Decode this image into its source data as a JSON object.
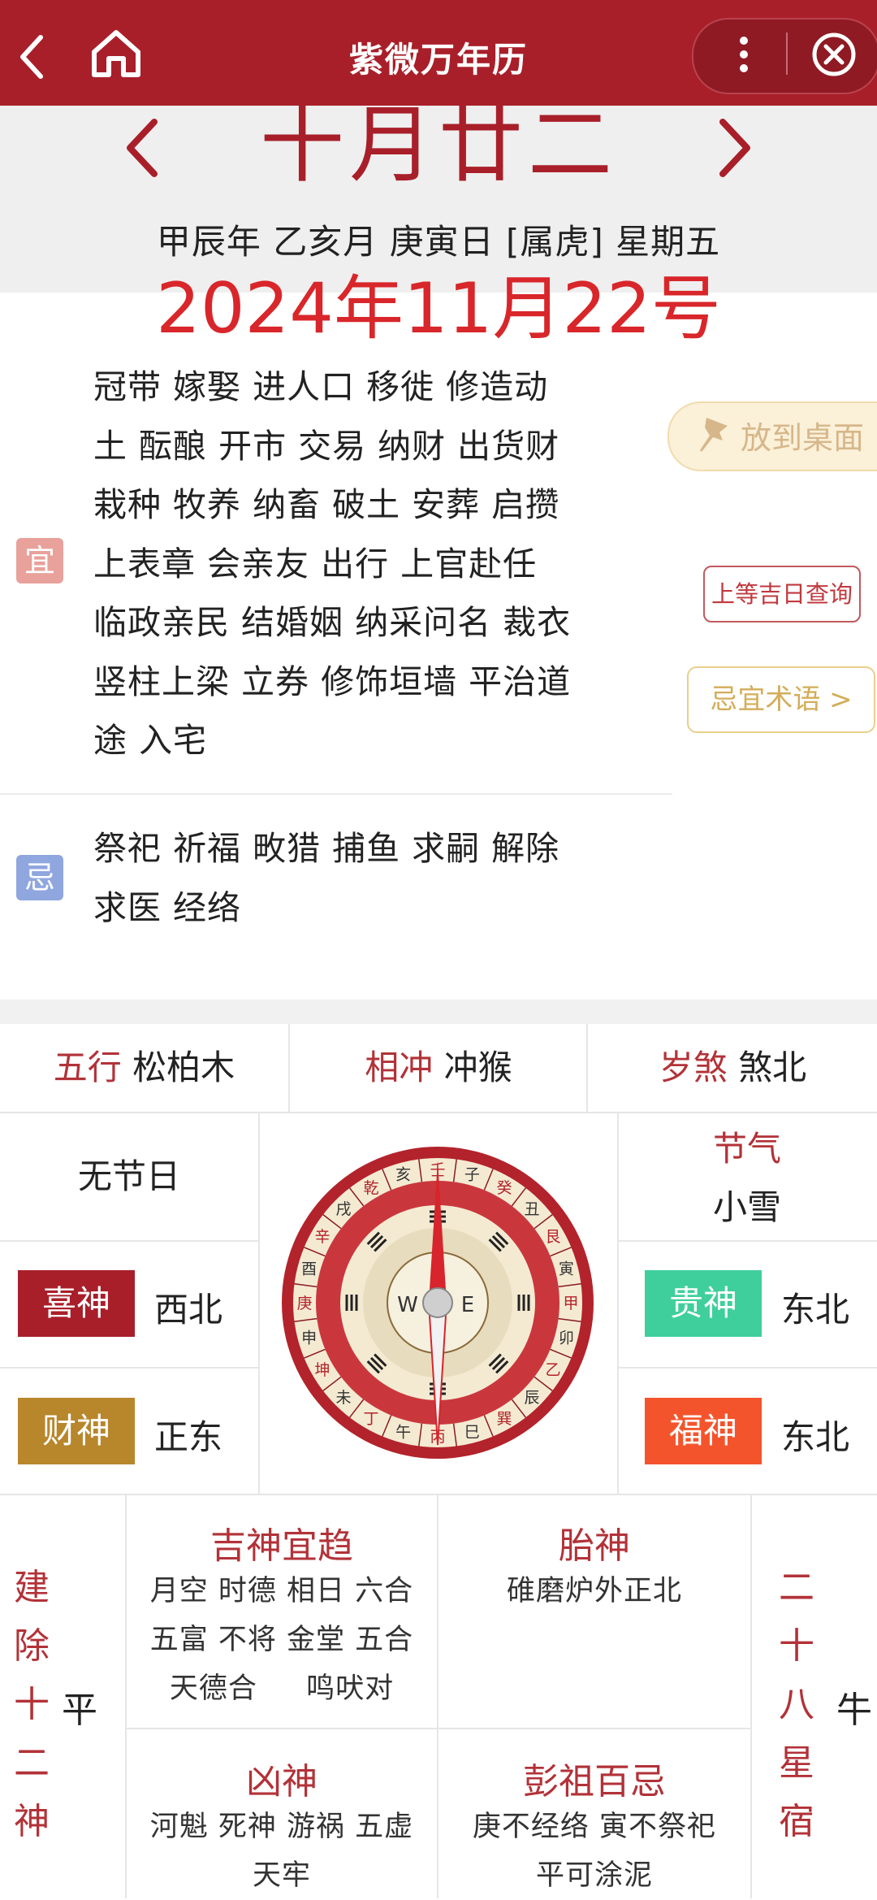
{
  "header": {
    "title": "紫微万年历"
  },
  "date": {
    "lunar": "十月廿二",
    "ganzhi": "甲辰年 乙亥月 庚寅日 [属虎] 星期五",
    "gregorian": "2024年11月22号"
  },
  "yi": {
    "tag": "宜",
    "lines": [
      "冠带 嫁娶 进人口 移徙 修造动",
      "土 酝酿 开市 交易 纳财 出货财",
      "栽种 牧养 纳畜 破土 安葬 启攒",
      "上表章 会亲友 出行 上官赴任",
      "临政亲民 结婚姻 纳采问名 裁衣",
      "竖柱上梁 立券 修饰垣墙 平治道",
      "途 入宅"
    ]
  },
  "ji": {
    "tag": "忌",
    "lines": [
      "祭祀 祈福 畋猎 捕鱼 求嗣 解除",
      "求医 经络"
    ]
  },
  "buttons": {
    "pin": "放到桌面",
    "query": "上等吉日查询",
    "terms": "忌宜术语 >"
  },
  "info": {
    "wuxing_label": "五行",
    "wuxing_value": "松柏木",
    "chong_label": "相冲",
    "chong_value": "冲猴",
    "sha_label": "岁煞",
    "sha_value": "煞北",
    "festival": "无节日",
    "jieqi_label": "节气",
    "jieqi_value": "小雪"
  },
  "gods": {
    "xi": {
      "label": "喜神",
      "value": "西北",
      "color": "#a81f2a"
    },
    "cai": {
      "label": "财神",
      "value": "正东",
      "color": "#b8862b"
    },
    "gui": {
      "label": "贵神",
      "value": "东北",
      "color": "#3fcf9c"
    },
    "fu": {
      "label": "福神",
      "value": "东北",
      "color": "#f4542c"
    }
  },
  "bottom": {
    "jianchu_chars": [
      "建",
      "除",
      "十",
      "二",
      "神"
    ],
    "jianchu_value": "平",
    "jishen_title": "吉神宜趋",
    "jishen_lines": [
      "月空 时德 相日 六合",
      "五富 不将 金堂 五合",
      "天德合 　 鸣吠对"
    ],
    "taishen_title": "胎神",
    "taishen_lines": [
      "碓磨炉外正北"
    ],
    "xiongshen_title": "凶神",
    "xiongshen_lines": [
      "河魁 死神 游祸 五虚",
      "天牢"
    ],
    "pengzu_title": "彭祖百忌",
    "pengzu_lines": [
      "庚不经络 寅不祭祀",
      "平可涂泥"
    ],
    "xingxiu_chars": [
      "二",
      "十",
      "八",
      "星",
      "宿"
    ],
    "xingxiu_value": "牛"
  },
  "compass": {
    "ring_labels": [
      "壬",
      "子",
      "癸",
      "丑",
      "艮",
      "寅",
      "甲",
      "卯",
      "乙",
      "辰",
      "巽",
      "巳",
      "丙",
      "午",
      "丁",
      "未",
      "坤",
      "申",
      "庚",
      "酉",
      "辛",
      "戌",
      "乾",
      "亥"
    ],
    "center_letters": [
      "W",
      "E"
    ],
    "colors": {
      "outer": "#b3232b",
      "needle": "#d8242c",
      "ring_light": "#f4ead2"
    }
  }
}
